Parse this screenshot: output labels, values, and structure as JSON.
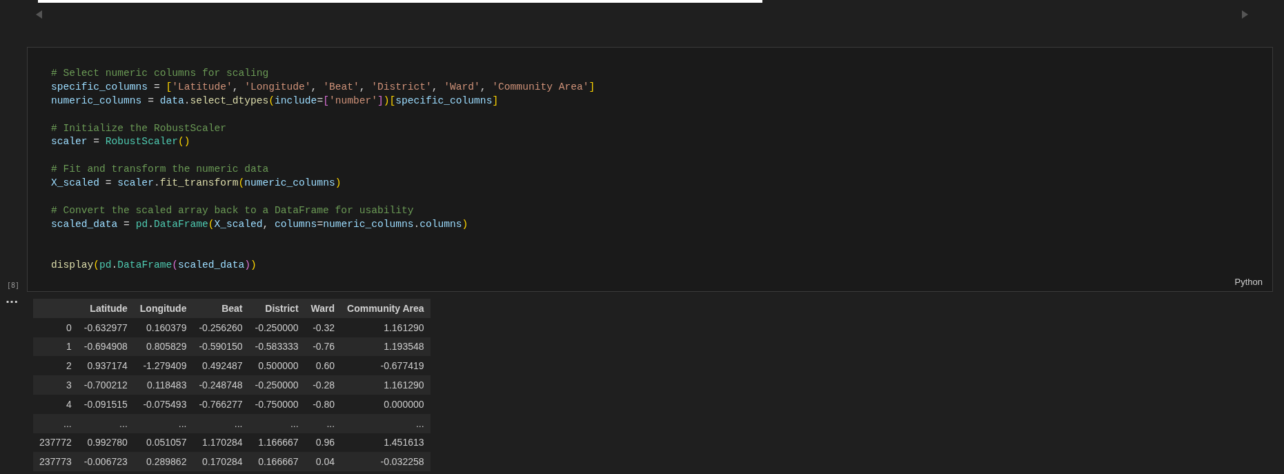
{
  "code_cell": {
    "execution_count": "[8]",
    "language": "Python",
    "lines": [
      {
        "kind": "code",
        "tokens": [
          {
            "kind": "comment",
            "text": "# Select numeric columns for scaling"
          }
        ]
      },
      {
        "kind": "code",
        "tokens": [
          {
            "kind": "var",
            "text": "specific_columns"
          },
          {
            "kind": "op",
            "text": " = "
          },
          {
            "kind": "bracket1",
            "text": "["
          },
          {
            "kind": "string",
            "text": "'Latitude'"
          },
          {
            "kind": "op",
            "text": ", "
          },
          {
            "kind": "string",
            "text": "'Longitude'"
          },
          {
            "kind": "op",
            "text": ", "
          },
          {
            "kind": "string",
            "text": "'Beat'"
          },
          {
            "kind": "op",
            "text": ", "
          },
          {
            "kind": "string",
            "text": "'District'"
          },
          {
            "kind": "op",
            "text": ", "
          },
          {
            "kind": "string",
            "text": "'Ward'"
          },
          {
            "kind": "op",
            "text": ", "
          },
          {
            "kind": "string",
            "text": "'Community Area'"
          },
          {
            "kind": "bracket1",
            "text": "]"
          }
        ]
      },
      {
        "kind": "code",
        "tokens": [
          {
            "kind": "var",
            "text": "numeric_columns"
          },
          {
            "kind": "op",
            "text": " = "
          },
          {
            "kind": "var",
            "text": "data"
          },
          {
            "kind": "op",
            "text": "."
          },
          {
            "kind": "func",
            "text": "select_dtypes"
          },
          {
            "kind": "bracket1",
            "text": "("
          },
          {
            "kind": "var",
            "text": "include"
          },
          {
            "kind": "op",
            "text": "="
          },
          {
            "kind": "bracket2",
            "text": "["
          },
          {
            "kind": "string",
            "text": "'number'"
          },
          {
            "kind": "bracket2",
            "text": "]"
          },
          {
            "kind": "bracket1",
            "text": ")["
          },
          {
            "kind": "var",
            "text": "specific_columns"
          },
          {
            "kind": "bracket1",
            "text": "]"
          }
        ]
      },
      {
        "kind": "blank"
      },
      {
        "kind": "code",
        "tokens": [
          {
            "kind": "comment",
            "text": "# Initialize the RobustScaler"
          }
        ]
      },
      {
        "kind": "code",
        "tokens": [
          {
            "kind": "var",
            "text": "scaler"
          },
          {
            "kind": "op",
            "text": " = "
          },
          {
            "kind": "class",
            "text": "RobustScaler"
          },
          {
            "kind": "bracket1",
            "text": "()"
          }
        ]
      },
      {
        "kind": "blank"
      },
      {
        "kind": "code",
        "tokens": [
          {
            "kind": "comment",
            "text": "# Fit and transform the numeric data"
          }
        ]
      },
      {
        "kind": "code",
        "tokens": [
          {
            "kind": "var",
            "text": "X_scaled"
          },
          {
            "kind": "op",
            "text": " = "
          },
          {
            "kind": "var",
            "text": "scaler"
          },
          {
            "kind": "op",
            "text": "."
          },
          {
            "kind": "func",
            "text": "fit_transform"
          },
          {
            "kind": "bracket1",
            "text": "("
          },
          {
            "kind": "var",
            "text": "numeric_columns"
          },
          {
            "kind": "bracket1",
            "text": ")"
          }
        ]
      },
      {
        "kind": "blank"
      },
      {
        "kind": "code",
        "tokens": [
          {
            "kind": "comment",
            "text": "# Convert the scaled array back to a DataFrame for usability"
          }
        ]
      },
      {
        "kind": "code",
        "tokens": [
          {
            "kind": "var",
            "text": "scaled_data"
          },
          {
            "kind": "op",
            "text": " = "
          },
          {
            "kind": "class",
            "text": "pd"
          },
          {
            "kind": "op",
            "text": "."
          },
          {
            "kind": "class",
            "text": "DataFrame"
          },
          {
            "kind": "bracket1",
            "text": "("
          },
          {
            "kind": "var",
            "text": "X_scaled"
          },
          {
            "kind": "op",
            "text": ", "
          },
          {
            "kind": "var",
            "text": "columns"
          },
          {
            "kind": "op",
            "text": "="
          },
          {
            "kind": "var",
            "text": "numeric_columns"
          },
          {
            "kind": "op",
            "text": "."
          },
          {
            "kind": "var",
            "text": "columns"
          },
          {
            "kind": "bracket1",
            "text": ")"
          }
        ]
      },
      {
        "kind": "blank"
      },
      {
        "kind": "blank"
      },
      {
        "kind": "code",
        "tokens": [
          {
            "kind": "func",
            "text": "display"
          },
          {
            "kind": "bracket1",
            "text": "("
          },
          {
            "kind": "class",
            "text": "pd"
          },
          {
            "kind": "op",
            "text": "."
          },
          {
            "kind": "class",
            "text": "DataFrame"
          },
          {
            "kind": "bracket2",
            "text": "("
          },
          {
            "kind": "var",
            "text": "scaled_data"
          },
          {
            "kind": "bracket2",
            "text": ")"
          },
          {
            "kind": "bracket1",
            "text": ")"
          }
        ]
      }
    ]
  },
  "output": {
    "menu": "...",
    "table": {
      "columns": [
        "Latitude",
        "Longitude",
        "Beat",
        "District",
        "Ward",
        "Community Area"
      ],
      "rows": [
        {
          "index": "0",
          "cells": [
            "-0.632977",
            "0.160379",
            "-0.256260",
            "-0.250000",
            "-0.32",
            "1.161290"
          ]
        },
        {
          "index": "1",
          "cells": [
            "-0.694908",
            "0.805829",
            "-0.590150",
            "-0.583333",
            "-0.76",
            "1.193548"
          ]
        },
        {
          "index": "2",
          "cells": [
            "0.937174",
            "-1.279409",
            "0.492487",
            "0.500000",
            "0.60",
            "-0.677419"
          ]
        },
        {
          "index": "3",
          "cells": [
            "-0.700212",
            "0.118483",
            "-0.248748",
            "-0.250000",
            "-0.28",
            "1.161290"
          ]
        },
        {
          "index": "4",
          "cells": [
            "-0.091515",
            "-0.075493",
            "-0.766277",
            "-0.750000",
            "-0.80",
            "0.000000"
          ]
        },
        {
          "index": "...",
          "cells": [
            "...",
            "...",
            "...",
            "...",
            "...",
            "..."
          ]
        },
        {
          "index": "237772",
          "cells": [
            "0.992780",
            "0.051057",
            "1.170284",
            "1.166667",
            "0.96",
            "1.451613"
          ]
        },
        {
          "index": "237773",
          "cells": [
            "-0.006723",
            "0.289862",
            "0.170284",
            "0.166667",
            "0.04",
            "-0.032258"
          ]
        }
      ]
    }
  }
}
